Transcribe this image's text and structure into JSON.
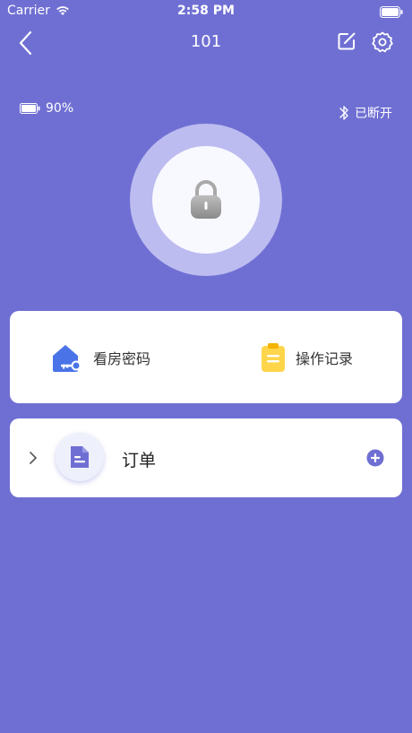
{
  "status_bar": {
    "carrier": "Carrier",
    "time": "2:58 PM",
    "wifi_icon": "wifi-icon",
    "battery_icon": "battery-icon"
  },
  "nav": {
    "title": "101",
    "back_icon": "chevron-left-icon",
    "edit_icon": "edit-icon",
    "settings_icon": "gear-icon"
  },
  "lock_status": {
    "battery_level": "90%",
    "bluetooth_status": "已断开",
    "bluetooth_icon": "bluetooth-icon",
    "lock_icon": "padlock-icon"
  },
  "actions": [
    {
      "label": "看房密码",
      "icon": "house-key-icon",
      "color": "#4a73e8"
    },
    {
      "label": "操作记录",
      "icon": "clipboard-icon",
      "color": "#ffd54a"
    }
  ],
  "orders": {
    "label": "订单",
    "icon": "document-icon",
    "add_icon": "plus-circle-icon",
    "expand_icon": "chevron-right-icon"
  },
  "colors": {
    "background": "#6f6fd3",
    "ring": "#bcbcf0",
    "accent": "#6f6fd3"
  }
}
